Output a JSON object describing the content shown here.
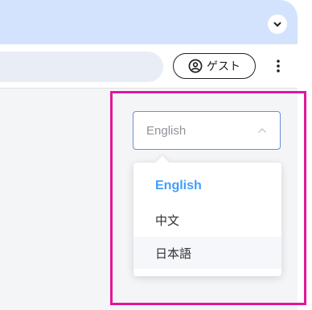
{
  "browser": {
    "profile_button_label": "ゲスト",
    "icons": {
      "tab_search": "chevron-down-icon",
      "profile": "account-circle-icon",
      "menu": "more-vertical-icon"
    }
  },
  "language_select": {
    "selected_value": "English",
    "options": [
      {
        "label": "English",
        "state": "selected"
      },
      {
        "label": "中文",
        "state": "default"
      },
      {
        "label": "日本語",
        "state": "hover"
      }
    ]
  },
  "colors": {
    "highlight_border": "#e3179a",
    "selected_option": "#409eff",
    "select_border": "#6c8fd4",
    "titlebar": "#d3e3fd"
  }
}
